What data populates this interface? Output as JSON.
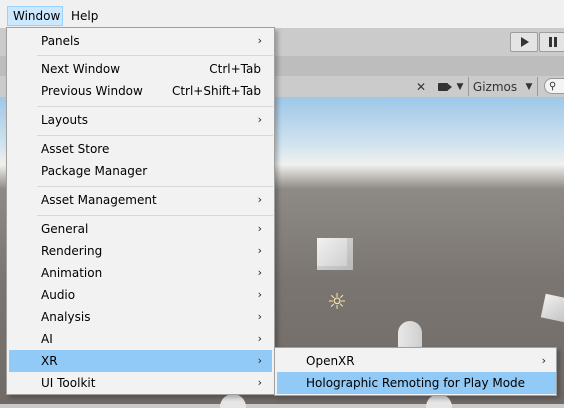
{
  "menubar": {
    "items": [
      "Window",
      "Help"
    ]
  },
  "scene_toolbar": {
    "gizmos_label": "Gizmos"
  },
  "window_menu": {
    "items": [
      {
        "label": "Panels",
        "submenu": true
      },
      {
        "label": "Next Window",
        "shortcut": "Ctrl+Tab"
      },
      {
        "label": "Previous Window",
        "shortcut": "Ctrl+Shift+Tab"
      },
      {
        "label": "Layouts",
        "submenu": true
      },
      {
        "label": "Asset Store"
      },
      {
        "label": "Package Manager"
      },
      {
        "label": "Asset Management",
        "submenu": true
      },
      {
        "label": "General",
        "submenu": true
      },
      {
        "label": "Rendering",
        "submenu": true
      },
      {
        "label": "Animation",
        "submenu": true
      },
      {
        "label": "Audio",
        "submenu": true
      },
      {
        "label": "Analysis",
        "submenu": true
      },
      {
        "label": "AI",
        "submenu": true
      },
      {
        "label": "XR",
        "submenu": true,
        "highlighted": true
      },
      {
        "label": "UI Toolkit",
        "submenu": true
      }
    ]
  },
  "xr_submenu": {
    "items": [
      {
        "label": "OpenXR",
        "submenu": true
      },
      {
        "label": "Holographic Remoting for Play Mode",
        "highlighted": true
      }
    ]
  },
  "colors": {
    "menu_highlight": "#91c9f7",
    "menubar_active": "#cce8ff"
  },
  "icons": [
    "play-icon",
    "pause-icon",
    "tools-icon",
    "camera-icon",
    "dropdown-icon",
    "search-icon",
    "light-icon",
    "submenu-arrow-icon"
  ]
}
